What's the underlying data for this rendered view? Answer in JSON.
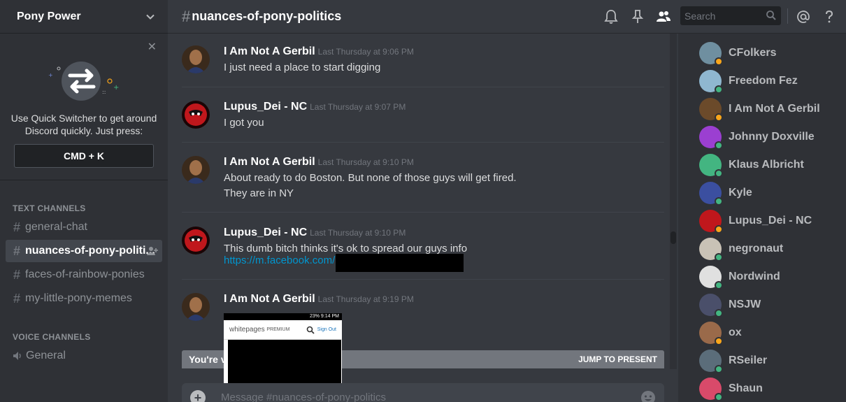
{
  "server": {
    "name": "Pony Power"
  },
  "quick_switcher": {
    "text_line1": "Use Quick Switcher to get around",
    "text_line2": "Discord quickly. Just press:",
    "shortcut": "CMD + K"
  },
  "categories": {
    "text": "TEXT CHANNELS",
    "voice": "VOICE CHANNELS"
  },
  "channels": [
    {
      "name": "general-chat",
      "active": false
    },
    {
      "name": "nuances-of-pony-politi...",
      "active": true
    },
    {
      "name": "faces-of-rainbow-ponies",
      "active": false
    },
    {
      "name": "my-little-pony-memes",
      "active": false
    }
  ],
  "voice_channels": [
    {
      "name": "General"
    }
  ],
  "header": {
    "hash": "#",
    "channel": "nuances-of-pony-politics"
  },
  "search": {
    "placeholder": "Search"
  },
  "messages": [
    {
      "author": "I Am Not A Gerbil",
      "timestamp": "Last Thursday at 9:06 PM",
      "lines": [
        "I just need a place to start digging"
      ]
    },
    {
      "author": "Lupus_Dei - NC",
      "timestamp": "Last Thursday at 9:07 PM",
      "lines": [
        "I got you"
      ]
    },
    {
      "author": "I Am Not A Gerbil",
      "timestamp": "Last Thursday at 9:10 PM",
      "lines": [
        "About ready to do Boston. But none of those guys will get fired.",
        "They are in NY"
      ]
    },
    {
      "author": "Lupus_Dei - NC",
      "timestamp": "Last Thursday at 9:10 PM",
      "lines": [
        "This dumb bitch thinks it's ok to spread our guys info"
      ],
      "link": "https://m.facebook.com/"
    },
    {
      "author": "I Am Not A Gerbil",
      "timestamp": "Last Thursday at 9:19 PM",
      "lines": []
    }
  ],
  "attachment": {
    "brand": "whitepages",
    "brand_suffix": "PREMIUM",
    "signout": "Sign Out",
    "status": "23% 9:14 PM"
  },
  "jump_bar": {
    "text": "You're vie",
    "button": "JUMP TO PRESENT"
  },
  "composer": {
    "placeholder": "Message #nuances-of-pony-politics"
  },
  "members": [
    {
      "name": "CFolkers",
      "status": "idle",
      "color": "#6f8fa0"
    },
    {
      "name": "Freedom Fez",
      "status": "online",
      "color": "#8fb7d0"
    },
    {
      "name": "I Am Not A Gerbil",
      "status": "idle",
      "color": "#6b4a2a"
    },
    {
      "name": "Johnny Doxville",
      "status": "online",
      "color": "#9b3fd1"
    },
    {
      "name": "Klaus Albricht",
      "status": "online",
      "color": "#43b581"
    },
    {
      "name": "Kyle",
      "status": "online",
      "color": "#3b4fa0"
    },
    {
      "name": "Lupus_Dei - NC",
      "status": "idle",
      "color": "#c0171c"
    },
    {
      "name": "negronaut",
      "status": "online",
      "color": "#c9c2b6"
    },
    {
      "name": "Nordwind",
      "status": "online",
      "color": "#e0e0e0"
    },
    {
      "name": "NSJW",
      "status": "online",
      "color": "#4a4f6a"
    },
    {
      "name": "ox",
      "status": "idle",
      "color": "#9a6a4a"
    },
    {
      "name": "RSeiler",
      "status": "online",
      "color": "#5b6d7a"
    },
    {
      "name": "Shaun",
      "status": "online",
      "color": "#d94a6a"
    }
  ],
  "colors": {
    "online": "#43b581",
    "idle": "#faa61a",
    "accent": "#7289da",
    "link": "#0096cf"
  }
}
